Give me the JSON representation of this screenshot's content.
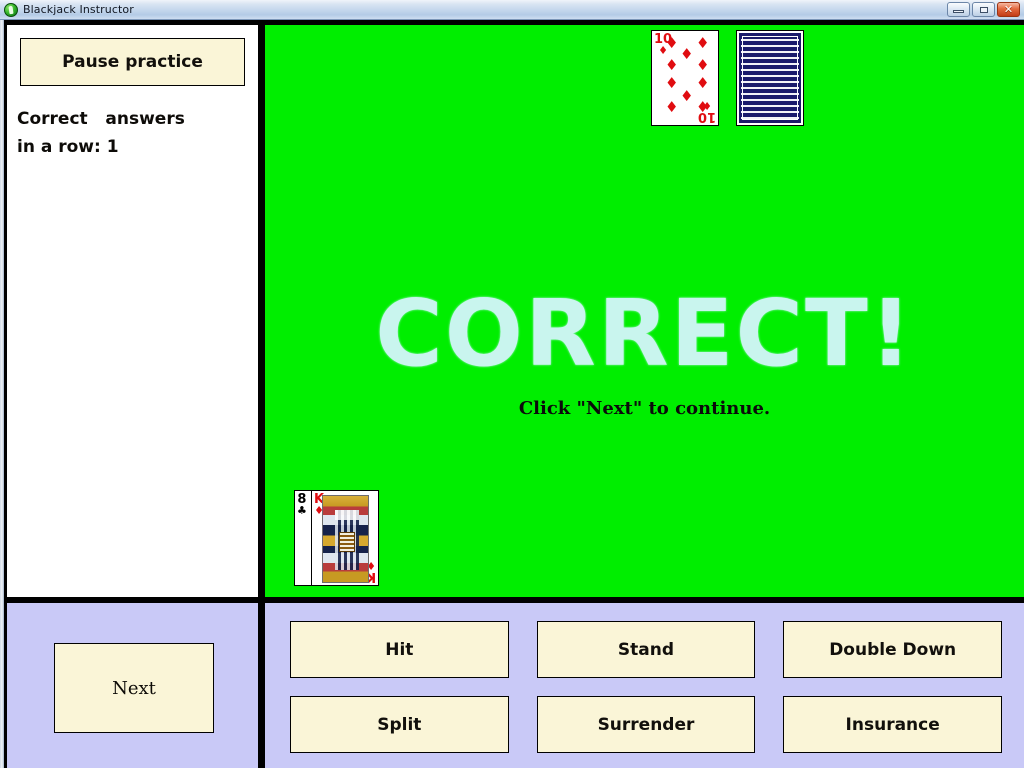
{
  "window": {
    "title": "Blackjack Instructor",
    "icon": "blackjack-app-icon",
    "controls": {
      "minimize": "minimize-button",
      "maximize": "maximize-button",
      "close": "close-button",
      "close_glyph": "✕"
    }
  },
  "colors": {
    "felt_green": "#00EE00",
    "panel_lavender": "#C9C9F7",
    "button_cream": "#FAF5D7",
    "verdict_text": "#C9F5EE",
    "card_red": "#E00C10",
    "card_back_navy": "#1B1B6B",
    "border_black": "#000000"
  },
  "sidebar": {
    "pause_button": "Pause practice",
    "stats": {
      "line1": "Correct   answers",
      "line2": "in a row: 1",
      "streak_value": "1"
    },
    "next_button": "Next"
  },
  "table": {
    "verdict": "CORRECT!",
    "subtext": "Click \"Next\" to continue.",
    "dealer_hand": [
      {
        "name": "ten-of-diamonds",
        "rank": "10",
        "suit": "♦",
        "suit_name": "diamonds",
        "color": "red",
        "face_up": true
      },
      {
        "name": "face-down-card",
        "rank": "",
        "suit": "",
        "suit_name": "hidden",
        "color": "",
        "face_up": false
      }
    ],
    "player_hand": [
      {
        "name": "eight-of-clubs",
        "rank": "8",
        "suit": "♣",
        "suit_name": "clubs",
        "color": "black",
        "face_up": true
      },
      {
        "name": "king-of-diamonds",
        "rank": "K",
        "suit": "♦",
        "suit_name": "diamonds",
        "color": "red",
        "face_up": true
      }
    ]
  },
  "actions": {
    "buttons": [
      {
        "label": "Hit",
        "name": "hit-button"
      },
      {
        "label": "Stand",
        "name": "stand-button"
      },
      {
        "label": "Double Down",
        "name": "double-down-button"
      },
      {
        "label": "Split",
        "name": "split-button"
      },
      {
        "label": "Surrender",
        "name": "surrender-button"
      },
      {
        "label": "Insurance",
        "name": "insurance-button"
      }
    ]
  }
}
